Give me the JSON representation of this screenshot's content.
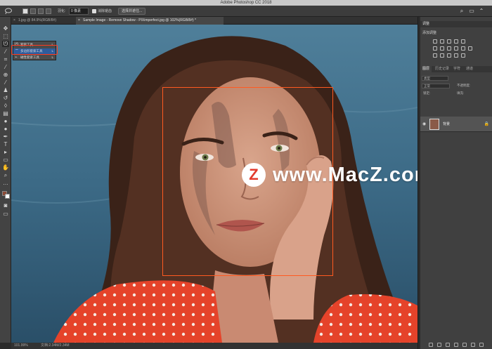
{
  "window": {
    "title": "Adobe Photoshop CC 2018"
  },
  "options_bar": {
    "feather_label": "羽化:",
    "feather_value": "0 像素",
    "antialias_label": "消除锯齿",
    "select_mask_button": "选择并遮住...",
    "right_icons": [
      "⌕",
      "▭",
      "⌃"
    ]
  },
  "tabs": [
    {
      "label": "1.jpg @ 84.9%(RGB/8#)"
    },
    {
      "label": "Sample Image - Remove Shadow - PIXimperfect.jpg @ 102%(RGB/8#) *"
    }
  ],
  "flyout": {
    "items": [
      {
        "label": "套索工具",
        "key": "L"
      },
      {
        "label": "多边形套索工具",
        "key": "L"
      },
      {
        "label": "磁性套索工具",
        "key": "L"
      }
    ]
  },
  "watermark": {
    "logo": "Z",
    "text": "www.MacZ.com"
  },
  "status": {
    "zoom": "101.99%",
    "doc": "文档:2.34M/2.34M"
  },
  "panels": {
    "adjust_header": "调整",
    "adjust_title": "添加调整",
    "layer_tabs": [
      "图层",
      "历史记录",
      "字符",
      "通道"
    ],
    "kind_label": "类型",
    "blend_mode": "正常",
    "opacity_label": "不透明度:",
    "lock_label": "锁定:",
    "fill_label": "填充:",
    "layer_name": "背景"
  },
  "colors": {
    "accent": "#ff5a20",
    "selection": "#2e5c9c",
    "background": "#2b2b2b"
  }
}
